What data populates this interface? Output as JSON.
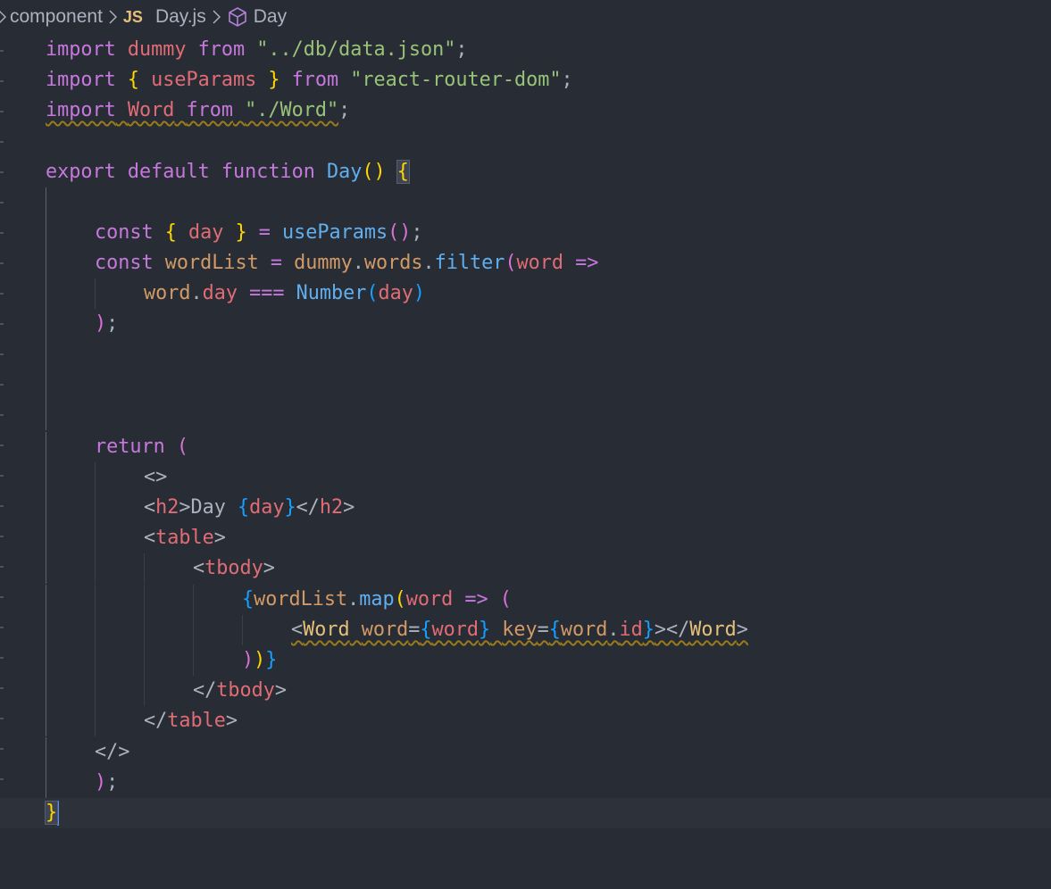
{
  "breadcrumb": {
    "folder": "component",
    "file_badge": "JS",
    "file": "Day.js",
    "symbol": "Day"
  },
  "code": {
    "l1": [
      "import",
      "dummy",
      "from",
      "\"../db/data.json\"",
      ";"
    ],
    "l2": [
      "import",
      "{",
      "useParams",
      "}",
      "from",
      "\"react-router-dom\"",
      ";"
    ],
    "l3": [
      "import",
      "Word",
      "from",
      "\"./Word\"",
      ";"
    ],
    "l5": [
      "export",
      "default",
      "function",
      "Day",
      "(",
      ")",
      "{"
    ],
    "l7": [
      "const",
      "{",
      "day",
      "}",
      "=",
      "useParams",
      "(",
      ")",
      ";"
    ],
    "l8": [
      "const",
      "wordList",
      "=",
      "dummy",
      ".",
      "words",
      ".",
      "filter",
      "(",
      "word",
      "=>"
    ],
    "l9": [
      "word",
      ".",
      "day",
      "===",
      "Number",
      "(",
      "day",
      ")"
    ],
    "l10": [
      ")",
      ";"
    ],
    "l14": [
      "return",
      "("
    ],
    "l15": [
      "<>"
    ],
    "l16": [
      "<",
      "h2",
      ">",
      "Day ",
      "{",
      "day",
      "}",
      "</",
      "h2",
      ">"
    ],
    "l17": [
      "<",
      "table",
      ">"
    ],
    "l18": [
      "<",
      "tbody",
      ">"
    ],
    "l19": [
      "{",
      "wordList",
      ".",
      "map",
      "(",
      "word",
      "=>",
      "("
    ],
    "l20": [
      "<",
      "Word",
      "word",
      "=",
      "{",
      "word",
      "}",
      "key",
      "=",
      "{",
      "word",
      ".",
      "id",
      "}",
      "></",
      "Word",
      ">"
    ],
    "l21": [
      ")",
      ")",
      "}"
    ],
    "l22": [
      "</",
      "tbody",
      ">"
    ],
    "l23": [
      "</",
      "table",
      ">"
    ],
    "l24": [
      "</>"
    ],
    "l25": [
      ")",
      ";"
    ],
    "l26": [
      "}"
    ]
  },
  "colors": {
    "background": "#282c34",
    "keyword": "#c678dd",
    "variable": "#e06c75",
    "string": "#98c379",
    "function": "#61afef",
    "component": "#e5c07b"
  },
  "icons": [
    "chevron-right-icon",
    "js-file-icon",
    "cube-symbol-icon"
  ]
}
